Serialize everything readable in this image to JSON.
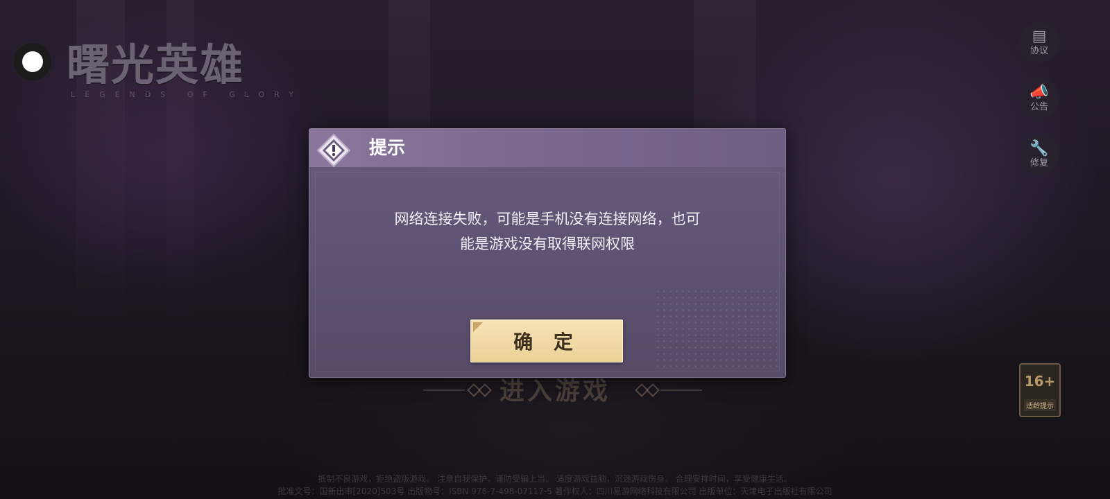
{
  "logo": {
    "title_cn": "曙光英雄",
    "subtitle_en": "LEGENDS OF GLORY"
  },
  "side_menu": [
    {
      "label": "协议",
      "icon": "document-icon"
    },
    {
      "label": "公告",
      "icon": "megaphone-icon"
    },
    {
      "label": "修复",
      "icon": "wrench-icon"
    }
  ],
  "age_badge": {
    "rating": "16+",
    "label": "适龄提示"
  },
  "enter_game": {
    "label": "进入游戏"
  },
  "footer": {
    "line1": "抵制不良游戏，拒绝盗版游戏。  注意自我保护，谨防受骗上当。  适度游戏益脑，沉迷游戏伤身。  合理安排时间，享受健康生活。",
    "line2": "批准文号：国新出审[2020]503号  出版物号：ISBN 978-7-498-07117-5  著作权人：四川易游网络科技有限公司  出版单位：天津电子出版社有限公司"
  },
  "dialog": {
    "title": "提示",
    "message_line1": "网络连接失败，可能是手机没有连接网络，也可",
    "message_line2": "能是游戏没有取得联网权限",
    "ok_label": "确 定"
  },
  "colors": {
    "dialog_bg": "#5e5171",
    "dialog_header": "#8a779c",
    "ok_button": "#ecd197"
  }
}
